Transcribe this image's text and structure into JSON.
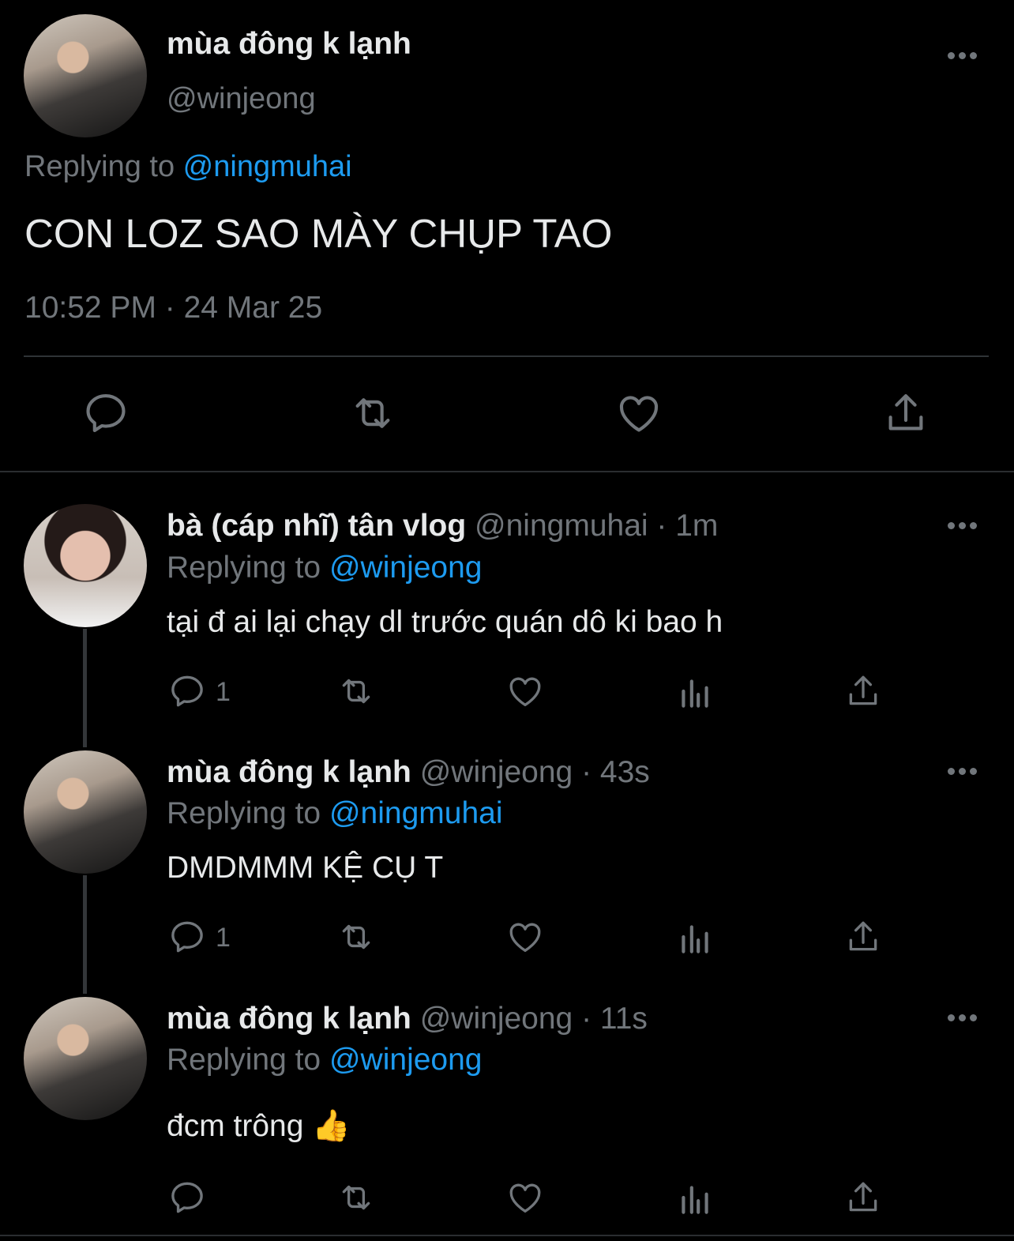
{
  "main_tweet": {
    "display_name": "mùa đông k lạnh",
    "handle": "@winjeong",
    "replying_prefix": "Replying to ",
    "replying_to": "@ningmuhai",
    "text": "CON LOZ SAO MÀY CHỤP TAO",
    "timestamp": "10:52 PM · 24 Mar 25"
  },
  "replies": [
    {
      "display_name": "bà (cáp nhĩ) tân vlog",
      "handle": "@ningmuhai",
      "time": " · 1m",
      "replying_prefix": "Replying to ",
      "replying_to": "@winjeong",
      "text": "tại đ ai lại chạy dl trước quán dô ki bao h",
      "reply_count": "1"
    },
    {
      "display_name": "mùa đông k lạnh",
      "handle": "@winjeong",
      "time": " · 43s",
      "replying_prefix": "Replying to ",
      "replying_to": "@ningmuhai",
      "text": "DMDMMM KỆ CỤ T",
      "reply_count": "1"
    },
    {
      "display_name": "mùa đông k lạnh",
      "handle": "@winjeong",
      "time": " · 11s",
      "replying_prefix": "Replying to ",
      "replying_to": "@winjeong",
      "text": "đcm trông 👍",
      "reply_count": ""
    }
  ],
  "colors": {
    "background": "#000000",
    "text": "#e7e9ea",
    "muted": "#71767b",
    "link": "#1d9bf0"
  },
  "icons": [
    "more-icon",
    "reply-icon",
    "retweet-icon",
    "like-icon",
    "views-icon",
    "share-icon"
  ]
}
